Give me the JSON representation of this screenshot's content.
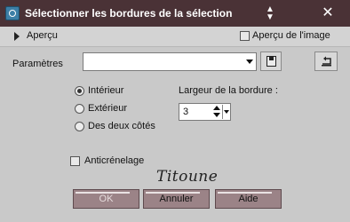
{
  "window": {
    "title": "Sélectionner les bordures de la sélection",
    "close_glyph": "✕"
  },
  "preview": {
    "toggle_label": "Aperçu",
    "preview_image_label": "Aperçu de l'image",
    "preview_image_checked": false
  },
  "params": {
    "label": "Paramètres",
    "preset_value": ""
  },
  "options": {
    "interior_label": "Intérieur",
    "exterior_label": "Extérieur",
    "both_label": "Des deux côtés",
    "selected": "interior"
  },
  "border_width": {
    "label": "Largeur de la bordure :",
    "value": "3"
  },
  "antialias": {
    "label": "Anticrénelage",
    "checked": false
  },
  "watermark": "Titoune",
  "buttons": {
    "ok_label": "OK",
    "cancel_label": "Annuler",
    "help_label": "Aide"
  },
  "icons": {
    "app": "app-icon",
    "pin": "pin-icon",
    "close": "close-icon",
    "save_preset": "disk-icon",
    "reset": "reset-icon"
  },
  "colors": {
    "titlebar": "#4a3236",
    "button": "#9b8387",
    "dialog_bg": "#c9c9c9"
  }
}
